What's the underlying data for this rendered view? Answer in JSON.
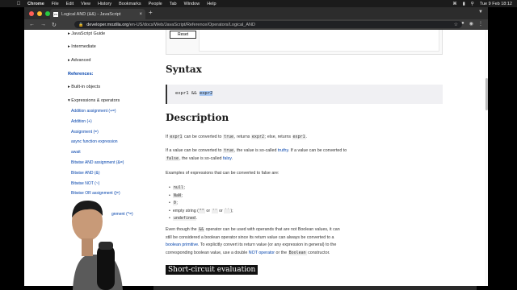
{
  "menubar": {
    "app": "Chrome",
    "items": [
      "File",
      "Edit",
      "View",
      "History",
      "Bookmarks",
      "People",
      "Tab",
      "Window",
      "Help"
    ],
    "clock": "Tue 9 Feb  18:12"
  },
  "tab": {
    "title": "Logical AND (&&) - JavaScript"
  },
  "address": {
    "host": "developer.mozilla.org",
    "path": "/en-US/docs/Web/JavaScript/Reference/Operators/Logical_AND"
  },
  "sidebar": {
    "items": [
      {
        "label": "JavaScript Guide"
      },
      {
        "label": "Intermediate"
      },
      {
        "label": "Advanced"
      }
    ],
    "references": "References:",
    "builtin": "Built-in objects",
    "expressions": "Expressions & operators",
    "links": [
      "Addition assignment (+=)",
      "Addition (+)",
      "Assignment (=)",
      "async function expression",
      "await",
      "Bitwise AND assignment (&=)",
      "Bitwise AND (&)",
      "Bitwise NOT (~)",
      "Bitwise OR assignment (|=)",
      "gnment (^=)"
    ]
  },
  "main": {
    "reset_label": "Reset",
    "syntax_heading": "Syntax",
    "syntax_code_a": "expr1 && ",
    "syntax_code_b": "expr2",
    "description_heading": "Description",
    "p1": {
      "a": "If ",
      "c1": "expr1",
      "b": " can be converted to ",
      "c2": "true",
      "c": ", returns ",
      "c3": "expr2",
      "d": "; else, returns ",
      "c4": "expr1",
      "e": "."
    },
    "p2": {
      "a": "If a value can be converted to ",
      "c1": "true",
      "b": ", the value is so-called ",
      "link1": "truthy",
      "c": ". If a value can be converted to",
      "c2": "false",
      "d": ", the value is so-called ",
      "link2": "falsy",
      "e": "."
    },
    "p3": "Examples of expressions that can be converted to false are:",
    "list": [
      "null",
      "NaN",
      "0"
    ],
    "empty_string": {
      "a": "empty string (",
      "c1": "\"\"",
      "b": " or ",
      "c2": "''",
      "c": " or ",
      "c3": "``",
      "d": ");"
    },
    "undefined": "undefined",
    "p4": {
      "a": "Even though the ",
      "c1": "&&",
      "b": " operator can be used with operands that are not Boolean values, it can",
      "line2": "still be considered a boolean operator since its return value can always be converted to a",
      "link1": "boolean primitive",
      "c": ". To explicitly convert its return value (or any expression in general) to the",
      "d": "corresponding boolean value, use a double ",
      "link2": "NOT operator",
      "e": " or the ",
      "c2": "Boolean",
      "f": " constructor."
    },
    "short_heading": "Short-circuit evaluation"
  },
  "colors": {
    "link": "#0645ad",
    "chrome_dark": "#2c2c2c",
    "menubar": "#1b1b1b"
  }
}
